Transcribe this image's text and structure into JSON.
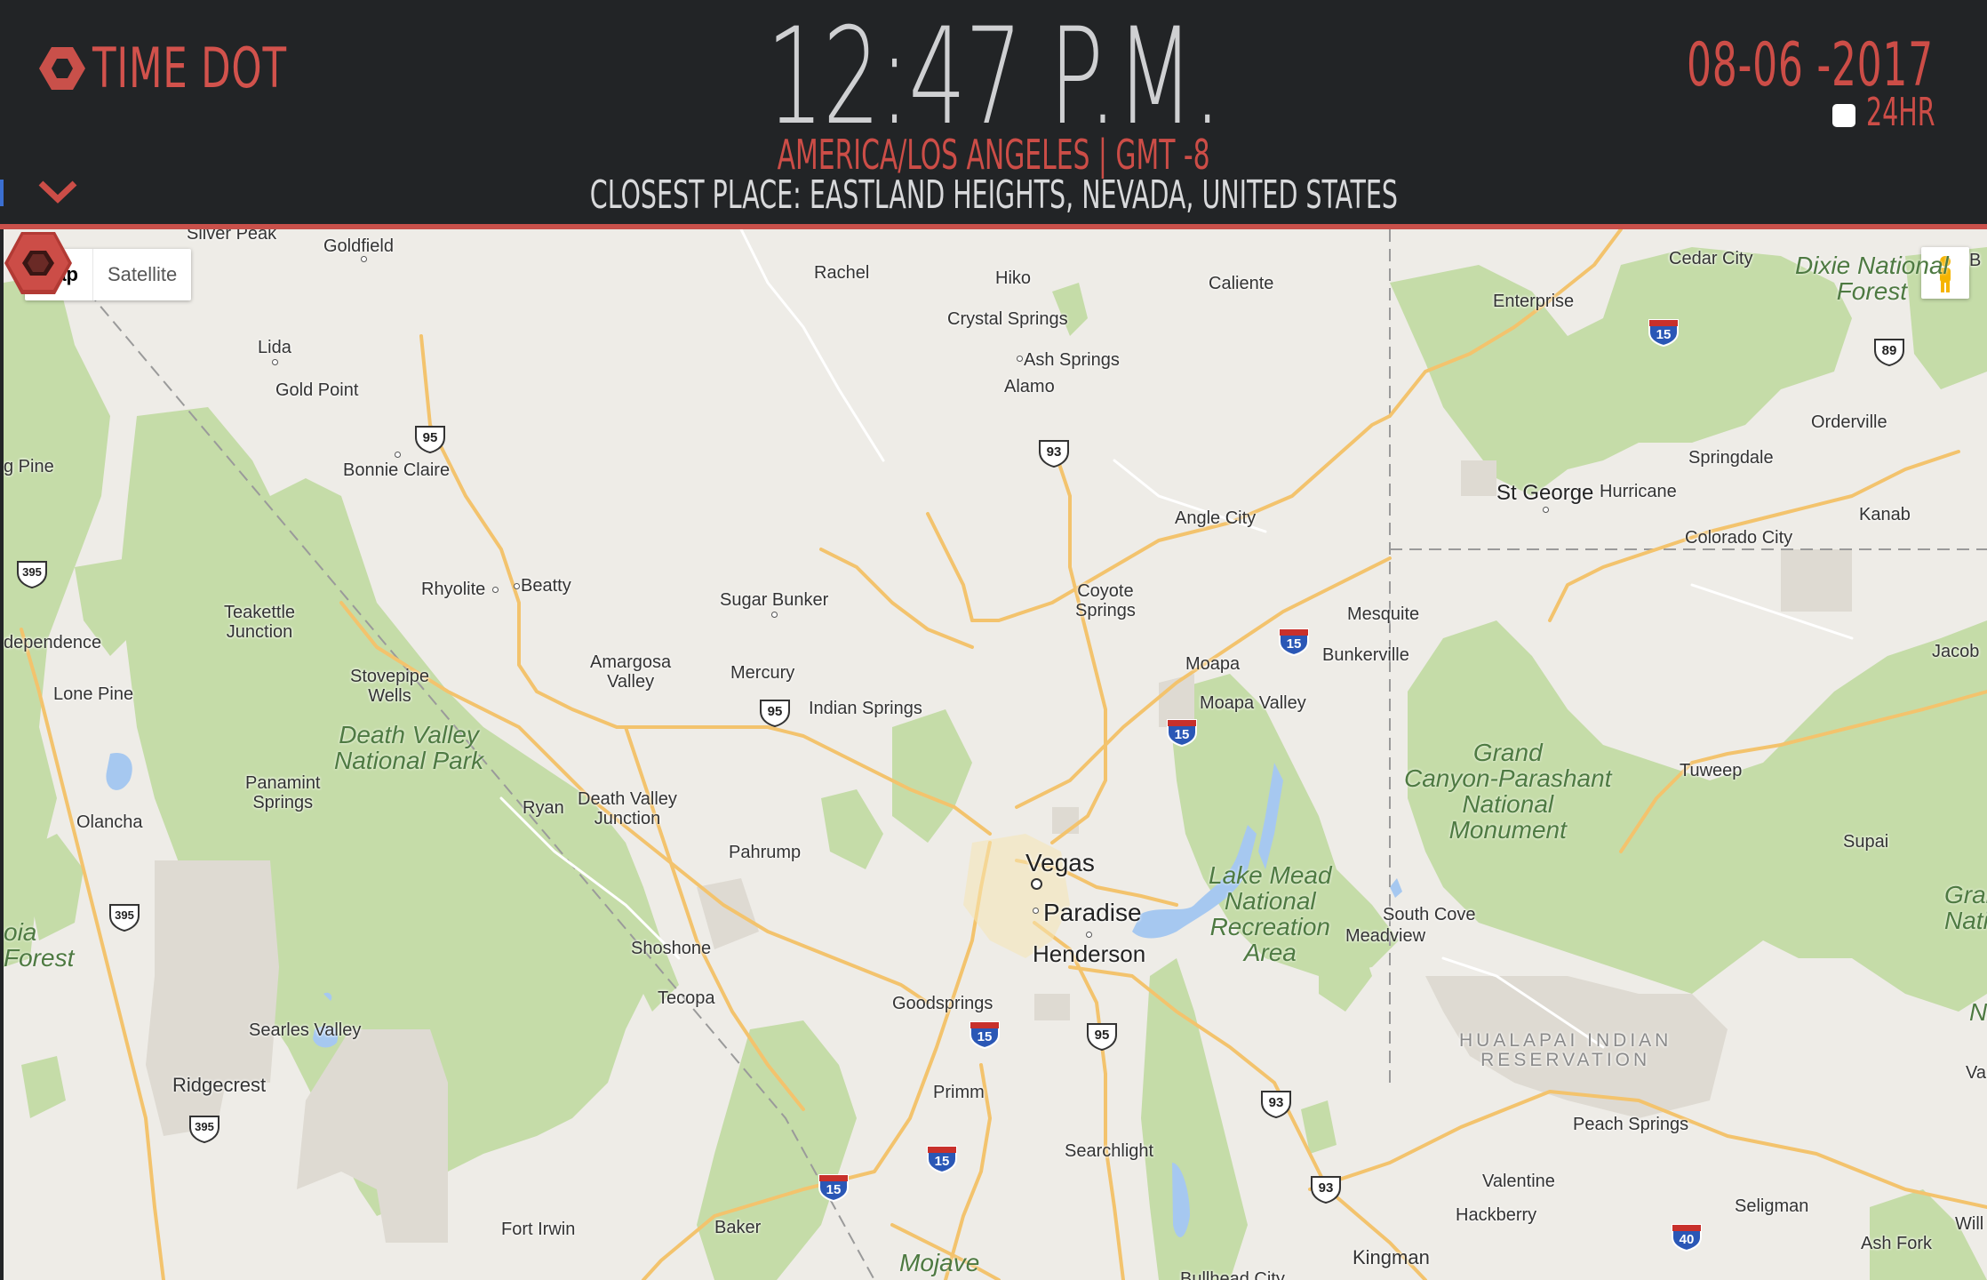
{
  "app": {
    "logo_text": "TIME DOT"
  },
  "clock": {
    "time": "12:47 P.M.",
    "timezone": "AMERICA/LOS ANGELES | GMT -8",
    "closest_place": "CLOSEST PLACE: EASTLAND HEIGHTS, NEVADA, UNITED STATES"
  },
  "date": {
    "value": "08-06 -2017",
    "format_label": "24HR",
    "format_24h_checked": false
  },
  "colors": {
    "accent": "#cc4d47",
    "header_bg": "#222426",
    "map_land": "#eeece7",
    "park": "#c4dda7",
    "water": "#a6c8f0"
  },
  "map": {
    "type_buttons": [
      "Map",
      "Satellite"
    ],
    "active_type": "Map",
    "labels": [
      {
        "name": "goldfield",
        "text": "Goldfield"
      },
      {
        "name": "rachel",
        "text": "Rachel"
      },
      {
        "name": "hiko",
        "text": "Hiko"
      },
      {
        "name": "caliente",
        "text": "Caliente"
      },
      {
        "name": "cedar-city",
        "text": "Cedar City"
      },
      {
        "name": "crystal-springs",
        "text": "Crystal Springs"
      },
      {
        "name": "ash-springs",
        "text": "Ash Springs"
      },
      {
        "name": "alamo",
        "text": "Alamo"
      },
      {
        "name": "enterprise",
        "text": "Enterprise"
      },
      {
        "name": "lida",
        "text": "Lida"
      },
      {
        "name": "gold-point",
        "text": "Gold Point"
      },
      {
        "name": "bonnie-claire",
        "text": "Bonnie Claire"
      },
      {
        "name": "big-pine",
        "text": "g Pine"
      },
      {
        "name": "orderville",
        "text": "Orderville"
      },
      {
        "name": "springdale",
        "text": "Springdale"
      },
      {
        "name": "st-george",
        "text": "St George"
      },
      {
        "name": "hurricane",
        "text": "Hurricane"
      },
      {
        "name": "kanab",
        "text": "Kanab"
      },
      {
        "name": "angle-city",
        "text": "Angle City"
      },
      {
        "name": "colorado-city",
        "text": "Colorado City"
      },
      {
        "name": "rhyolite",
        "text": "Rhyolite"
      },
      {
        "name": "beatty",
        "text": "Beatty"
      },
      {
        "name": "sugar-bunker",
        "text": "Sugar Bunker"
      },
      {
        "name": "coyote-springs",
        "text": "Coyote\nSprings"
      },
      {
        "name": "mesquite",
        "text": "Mesquite"
      },
      {
        "name": "bunkerville",
        "text": "Bunkerville"
      },
      {
        "name": "teakettle-junction",
        "text": "Teakettle\nJunction"
      },
      {
        "name": "independence",
        "text": "dependence"
      },
      {
        "name": "amargosa-valley",
        "text": "Amargosa\nValley"
      },
      {
        "name": "mercury",
        "text": "Mercury"
      },
      {
        "name": "moapa",
        "text": "Moapa"
      },
      {
        "name": "jacob",
        "text": "Jacob"
      },
      {
        "name": "stovepipe-wells",
        "text": "Stovepipe\nWells"
      },
      {
        "name": "lone-pine",
        "text": "Lone Pine"
      },
      {
        "name": "indian-springs",
        "text": "Indian Springs"
      },
      {
        "name": "moapa-valley",
        "text": "Moapa Valley"
      },
      {
        "name": "tuweep",
        "text": "Tuweep"
      },
      {
        "name": "panamint-springs",
        "text": "Panamint\nSprings"
      },
      {
        "name": "ryan",
        "text": "Ryan"
      },
      {
        "name": "death-valley-junction",
        "text": "Death Valley\nJunction"
      },
      {
        "name": "olancha",
        "text": "Olancha"
      },
      {
        "name": "pahrump",
        "text": "Pahrump"
      },
      {
        "name": "supai",
        "text": "Supai"
      },
      {
        "name": "vegas",
        "text": "Vegas"
      },
      {
        "name": "paradise",
        "text": "Paradise"
      },
      {
        "name": "south-cove",
        "text": "South Cove"
      },
      {
        "name": "meadview",
        "text": "Meadview"
      },
      {
        "name": "henderson",
        "text": "Henderson"
      },
      {
        "name": "shoshone",
        "text": "Shoshone"
      },
      {
        "name": "tecopa",
        "text": "Tecopa"
      },
      {
        "name": "goodsprings",
        "text": "Goodsprings"
      },
      {
        "name": "searles-valley",
        "text": "Searles Valley"
      },
      {
        "name": "ridgecrest",
        "text": "Ridgecrest"
      },
      {
        "name": "primm",
        "text": "Primm"
      },
      {
        "name": "peach-springs",
        "text": "Peach Springs"
      },
      {
        "name": "searchlight",
        "text": "Searchlight"
      },
      {
        "name": "valentine",
        "text": "Valentine"
      },
      {
        "name": "hackberry",
        "text": "Hackberry"
      },
      {
        "name": "seligman",
        "text": "Seligman"
      },
      {
        "name": "fort-irwin",
        "text": "Fort Irwin"
      },
      {
        "name": "baker",
        "text": "Baker"
      },
      {
        "name": "kingman",
        "text": "Kingman"
      },
      {
        "name": "ash-fork",
        "text": "Ash Fork"
      },
      {
        "name": "bullhead-city",
        "text": "Bullhead City"
      },
      {
        "name": "williams",
        "text": "Will"
      },
      {
        "name": "vail",
        "text": "Va"
      },
      {
        "name": "silver-peak",
        "text": "Silver Peak"
      },
      {
        "name": "edge-b",
        "text": "B"
      }
    ],
    "parks": [
      {
        "name": "death-valley-np",
        "text": "Death Valley\nNational Park"
      },
      {
        "name": "dixie-nf",
        "text": "Dixie National\nForest"
      },
      {
        "name": "grand-canyon-parashant",
        "text": "Grand\nCanyon-Parashant\nNational\nMonument"
      },
      {
        "name": "lake-mead",
        "text": "Lake Mead\nNational\nRecreation\nArea"
      },
      {
        "name": "inyo-nf",
        "text": "oia\nForest"
      },
      {
        "name": "grand-canyon-np",
        "text": "Gran\nNati"
      },
      {
        "name": "mojave",
        "text": "Mojave"
      },
      {
        "name": "kaibab-n",
        "text": "N"
      }
    ],
    "reservation": {
      "text": "HUALAPAI INDIAN\nRESERVATION"
    },
    "shields": [
      {
        "name": "us95-north",
        "num": "95",
        "type": "us"
      },
      {
        "name": "us93-alamo",
        "num": "93",
        "type": "us"
      },
      {
        "name": "ca395-north",
        "num": "395",
        "type": "us"
      },
      {
        "name": "i15-cedar",
        "num": "15",
        "type": "i"
      },
      {
        "name": "ut89",
        "num": "89",
        "type": "us"
      },
      {
        "name": "i15-mesquite",
        "num": "15",
        "type": "i"
      },
      {
        "name": "us95-mercury",
        "num": "95",
        "type": "us"
      },
      {
        "name": "i15-moapa",
        "num": "15",
        "type": "i"
      },
      {
        "name": "ca395-olancha",
        "num": "395",
        "type": "us"
      },
      {
        "name": "i15-goodsprings",
        "num": "15",
        "type": "i"
      },
      {
        "name": "us95-henderson",
        "num": "95",
        "type": "us"
      },
      {
        "name": "us93-south",
        "num": "93",
        "type": "us"
      },
      {
        "name": "ca395-ridgecrest",
        "num": "395",
        "type": "us"
      },
      {
        "name": "i15-primm",
        "num": "15",
        "type": "i"
      },
      {
        "name": "i15-baker",
        "num": "15",
        "type": "i"
      },
      {
        "name": "us93-kingman",
        "num": "93",
        "type": "us"
      },
      {
        "name": "i40",
        "num": "40",
        "type": "i"
      }
    ]
  }
}
